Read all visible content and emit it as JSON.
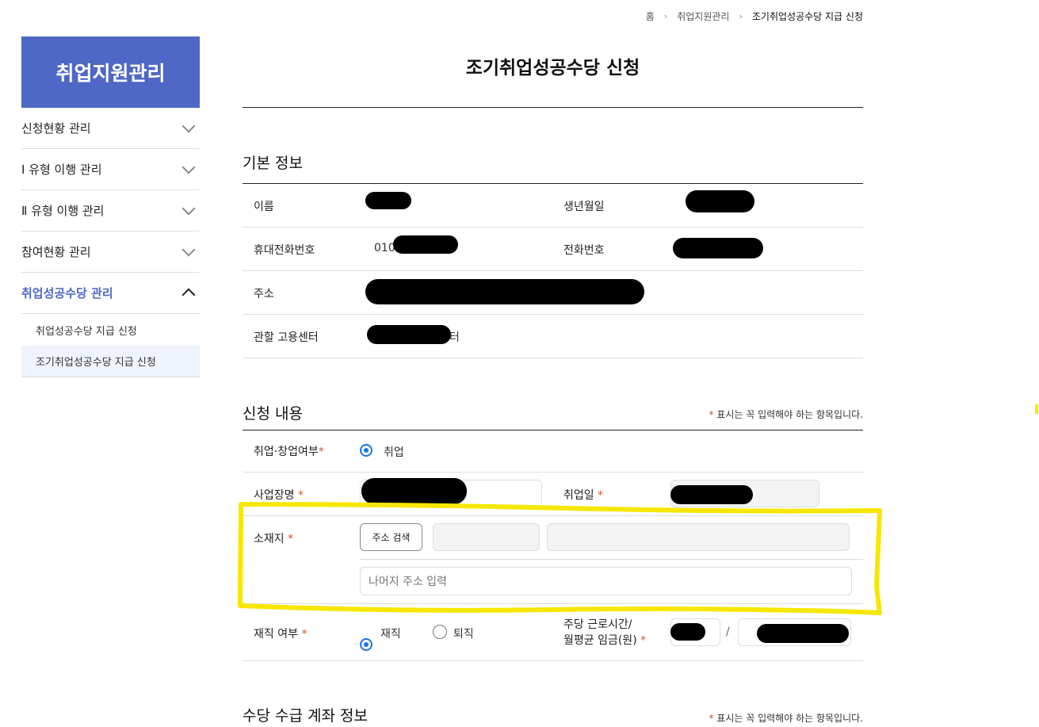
{
  "breadcrumb": {
    "home": "홈",
    "level1": "취업지원관리",
    "current": "조기취업성공수당 지급 신청"
  },
  "sidebar": {
    "title": "취업지원관리",
    "items": [
      {
        "label": "신청현황 관리"
      },
      {
        "label": "Ⅰ 유형 이행 관리"
      },
      {
        "label": "Ⅱ 유형 이행 관리"
      },
      {
        "label": "참여현황 관리"
      },
      {
        "label": "취업성공수당 관리"
      }
    ],
    "subitems": [
      {
        "label": "취업성공수당 지급 신청"
      },
      {
        "label": "조기취업성공수당 지급 신청"
      }
    ]
  },
  "page": {
    "title": "조기취업성공수당 신청"
  },
  "basic": {
    "title": "기본 정보",
    "name_label": "이름",
    "birth_label": "생년월일",
    "mobile_label": "휴대전화번호",
    "mobile_prefix": "010",
    "phone_label": "전화번호",
    "address_label": "주소",
    "center_label": "관할 고용센터",
    "center_suffix": "터"
  },
  "apply": {
    "title": "신청 내용",
    "required_note": "표시는 꼭 입력해야 하는 항목입니다.",
    "employ_type_label": "취업·창업여부",
    "employ_type_option": "취업",
    "company_label": "사업장명",
    "employ_date_label": "취업일",
    "location_label": "소재지",
    "address_search_button": "주소 검색",
    "address_detail_placeholder": "나머지 주소 입력",
    "work_status_label": "재직 여부",
    "work_status_options": [
      "재직",
      "퇴직"
    ],
    "hours_label_line1": "주당 근로시간/",
    "hours_label_line2": "월평균 임금(원)",
    "slash": "/"
  },
  "account": {
    "title": "수당 수급 계좌 정보",
    "required_note": "표시는 꼭 입력해야 하는 항목입니다."
  },
  "colors": {
    "accent": "#4f68c6",
    "required": "#d9541e",
    "highlight": "#f6e700"
  },
  "star": "*"
}
